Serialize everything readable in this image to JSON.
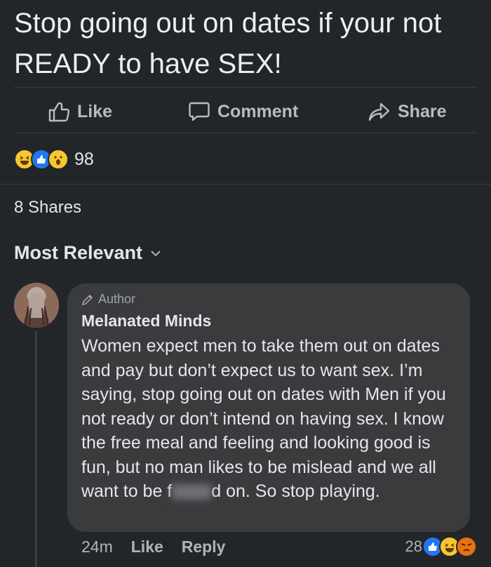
{
  "post": {
    "text": "Stop going out on dates if your not READY to have SEX!"
  },
  "actions": {
    "like": "Like",
    "comment": "Comment",
    "share": "Share"
  },
  "reactions": {
    "count": "98",
    "icons": [
      "haha",
      "like",
      "wow"
    ]
  },
  "shares": "8 Shares",
  "sort": {
    "label": "Most Relevant"
  },
  "comment": {
    "author_tag": "Author",
    "name": "Melanated Minds",
    "body_before_redaction": "Women expect men to take them out on dates and pay but don’t expect us to want sex. I’m saying, stop going out on dates with Men if you not ready or don’t intend on having sex. I know the free meal and feeling and looking good is fun, but no man likes to be mislead and we all want to be f",
    "body_after_redaction": "d on. So stop playing.",
    "time": "24m",
    "like": "Like",
    "reply": "Reply",
    "reaction_count": "28",
    "reaction_icons": [
      "like",
      "haha",
      "angry"
    ]
  },
  "colors": {
    "background": "#232629",
    "bubble": "#3a3b3c",
    "like_blue": "#2078f4",
    "haha_yellow": "#f7c631",
    "angry_orange": "#e9710f"
  }
}
